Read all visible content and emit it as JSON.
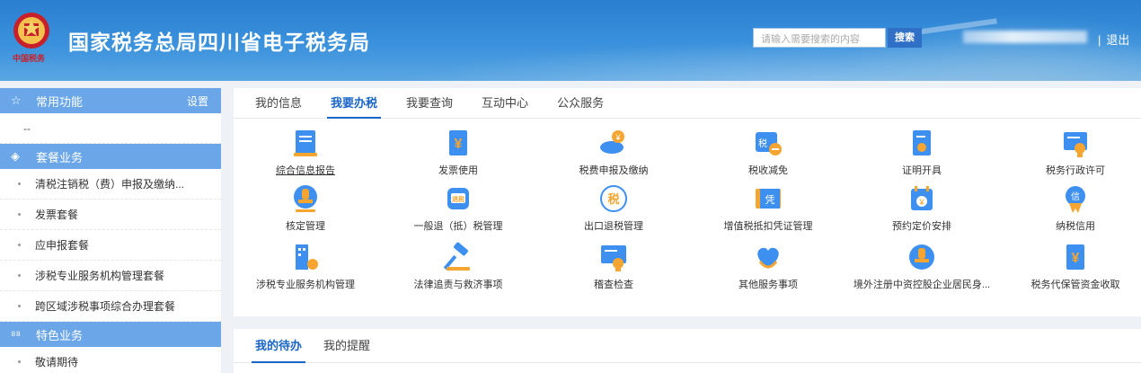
{
  "header": {
    "title": "国家税务总局四川省电子税务局",
    "search_placeholder": "请输入需要搜索的内容",
    "search_button": "搜索",
    "logout": "退出",
    "separator": "|"
  },
  "sidebar": {
    "common": {
      "label": "常用功能",
      "setting": "设置",
      "placeholder_item": "--"
    },
    "package": {
      "label": "套餐业务",
      "items": [
        "清税注销税（费）申报及缴纳...",
        "发票套餐",
        "应申报套餐",
        "涉税专业服务机构管理套餐",
        "跨区域涉税事项综合办理套餐"
      ]
    },
    "special": {
      "label": "特色业务",
      "items": [
        "敬请期待"
      ]
    }
  },
  "main": {
    "tabs": [
      "我的信息",
      "我要办税",
      "我要查询",
      "互动中心",
      "公众服务"
    ],
    "active_tab": "我要办税",
    "functions": [
      {
        "label": "综合信息报告",
        "icon": "report-icon"
      },
      {
        "label": "发票使用",
        "icon": "invoice-icon"
      },
      {
        "label": "税费申报及缴纳",
        "icon": "tax-payment-icon"
      },
      {
        "label": "税收减免",
        "icon": "tax-relief-icon"
      },
      {
        "label": "证明开具",
        "icon": "certificate-icon"
      },
      {
        "label": "税务行政许可",
        "icon": "license-icon"
      },
      {
        "label": "核定管理",
        "icon": "stamp-icon"
      },
      {
        "label": "一般退（抵）税管理",
        "icon": "refund-icon"
      },
      {
        "label": "出口退税管理",
        "icon": "export-refund-icon"
      },
      {
        "label": "增值税抵扣凭证管理",
        "icon": "voucher-icon"
      },
      {
        "label": "预约定价安排",
        "icon": "pricing-calendar-icon"
      },
      {
        "label": "纳税信用",
        "icon": "credit-icon"
      },
      {
        "label": "涉税专业服务机构管理",
        "icon": "agency-icon"
      },
      {
        "label": "法律追责与救济事项",
        "icon": "gavel-icon"
      },
      {
        "label": "稽查检查",
        "icon": "inspection-icon"
      },
      {
        "label": "其他服务事项",
        "icon": "heart-icon"
      },
      {
        "label": "境外注册中资控股企业居民身...",
        "icon": "overseas-icon"
      },
      {
        "label": "税务代保管资金收取",
        "icon": "custody-icon"
      }
    ],
    "bottom_tabs": [
      "我的待办",
      "我的提醒"
    ],
    "bottom_active": "我的待办"
  },
  "colors": {
    "accent": "#1a66c8",
    "sidebar_head": "#6aa6e8",
    "icon_blue": "#3d8ff0",
    "icon_orange": "#f7a531"
  }
}
